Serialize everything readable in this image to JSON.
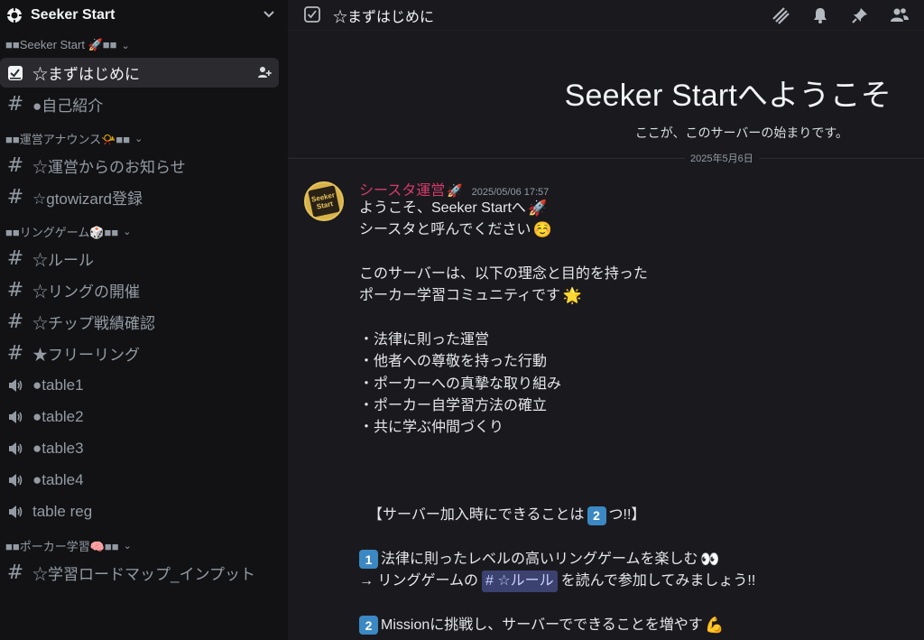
{
  "server": {
    "name": "Seeker Start"
  },
  "sidebar": {
    "categories": [
      {
        "label": "■■Seeker Start 🚀■■"
      },
      {
        "label": "■■運営アナウンス📯■■"
      },
      {
        "label": "■■リングゲーム🎲■■"
      },
      {
        "label": "■■ポーカー学習🧠■■"
      }
    ],
    "channels": [
      {
        "label": "☆まずはじめに"
      },
      {
        "label": "●自己紹介"
      },
      {
        "label": "☆運営からのお知らせ"
      },
      {
        "label": "☆gtowizard登録"
      },
      {
        "label": "☆ルール"
      },
      {
        "label": "☆リングの開催"
      },
      {
        "label": "☆チップ戦績確認"
      },
      {
        "label": "★フリーリング"
      },
      {
        "label": "●table1"
      },
      {
        "label": "●table2"
      },
      {
        "label": "●table3"
      },
      {
        "label": "●table4"
      },
      {
        "label": "table reg"
      },
      {
        "label": "☆学習ロードマップ_インプット"
      }
    ]
  },
  "topbar": {
    "title": "☆まずはじめに"
  },
  "welcome": {
    "title": "Seeker Startへようこそ",
    "subtitle": "ここが、このサーバーの始まりです。"
  },
  "divider": {
    "date": "2025年5月6日"
  },
  "message": {
    "author": "シースタ運営",
    "author_emoji": "🚀",
    "timestamp": "2025/05/06 17:57",
    "avatar_text": "Seeker Start",
    "lines": {
      "l1": "ようこそ、Seeker Startへ",
      "l1_emoji": "🚀",
      "l2": "シースタと呼んでください",
      "l2_emoji": "☺️",
      "l3": "このサーバーは、以下の理念と目的を持った",
      "l4": "ポーカー学習コミュニティです",
      "l4_emoji": "🌟",
      "b1": "・法律に則った運営",
      "b2": "・他者への尊敬を持った行動",
      "b3": "・ポーカーへの真摯な取り組み",
      "b4": "・ポーカー自学習方法の確立",
      "b5": "・共に学ぶ仲間づくり",
      "h1_pre": "【サーバー加入時にできることは",
      "h1_key": "2",
      "h1_post": "つ!!】",
      "i1_key": "1",
      "i1_text": "法律に則ったレベルの高いリングゲームを楽しむ",
      "i1_emoji": "👀",
      "i1b_pre": "→ リングゲームの",
      "i1b_mention": "# ☆ルール",
      "i1b_post": "を読んで参加してみましょう!!",
      "i2_key": "2",
      "i2_text": "Missionに挑戦し、サーバーでできることを増やす",
      "i2_emoji": "💪"
    }
  },
  "colors": {
    "sidebar_bg": "#121214",
    "main_bg": "#1a1a1e",
    "active_channel_bg": "#2a2a2f",
    "author_color": "#d73a6a",
    "keycap_blue": "#3b88c3",
    "mention_bg": "#3c4270"
  },
  "icons": {
    "server": "server-logo-icon",
    "channel_text": "hash-icon",
    "channel_voice": "speaker-icon",
    "channel_rules": "rules-checkbox-icon",
    "topbar_tools": [
      "threads-icon",
      "bell-icon",
      "pin-icon",
      "members-icon"
    ]
  }
}
